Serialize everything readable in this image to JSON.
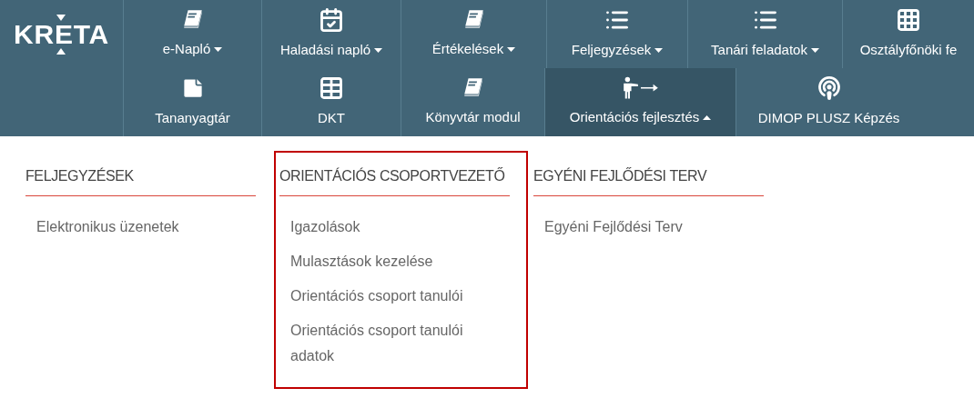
{
  "logo": {
    "text": "KRETA"
  },
  "nav_rows": [
    {
      "items": [
        {
          "label": "e-Napló",
          "kind": "book",
          "dropdown": true,
          "expanded": false,
          "selected": false
        },
        {
          "label": "Haladási napló",
          "kind": "calendar",
          "dropdown": true,
          "expanded": false,
          "selected": false
        },
        {
          "label": "Értékelések",
          "kind": "book",
          "dropdown": true,
          "expanded": false,
          "selected": false
        },
        {
          "label": "Feljegyzések",
          "kind": "list",
          "dropdown": true,
          "expanded": false,
          "selected": false
        },
        {
          "label": "Tanári feladatok",
          "kind": "list",
          "dropdown": true,
          "expanded": false,
          "selected": false
        },
        {
          "label": "Osztályfőnöki fe",
          "kind": "grid",
          "dropdown": false,
          "selected": false
        }
      ]
    },
    {
      "items": [
        {
          "label": "Tananyagtár",
          "kind": "note",
          "dropdown": false,
          "selected": false
        },
        {
          "label": "DKT",
          "kind": "table",
          "dropdown": false,
          "selected": false
        },
        {
          "label": "Könyvtár modul",
          "kind": "book",
          "dropdown": false,
          "selected": false
        },
        {
          "label": "Orientációs fejlesztés",
          "kind": "pointing",
          "dropdown": true,
          "expanded": true,
          "selected": true
        },
        {
          "label": "DIMOP PLUSZ Képzés",
          "kind": "podcast",
          "dropdown": false,
          "selected": false
        }
      ]
    }
  ],
  "menu_columns": [
    {
      "heading": "FELJEGYZÉSEK",
      "highlighted": false,
      "items": [
        "Elektronikus üzenetek"
      ]
    },
    {
      "heading": "ORIENTÁCIÓS CSOPORTVEZETŐ",
      "highlighted": true,
      "items": [
        "Igazolások",
        "Mulasztások kezelése",
        "Orientációs csoport tanulói",
        "Orientációs csoport tanulói adatok"
      ]
    },
    {
      "heading": "EGYÉNI FEJLŐDÉSI TERV",
      "highlighted": false,
      "items": [
        "Egyéni Fejlődési Terv"
      ]
    }
  ]
}
